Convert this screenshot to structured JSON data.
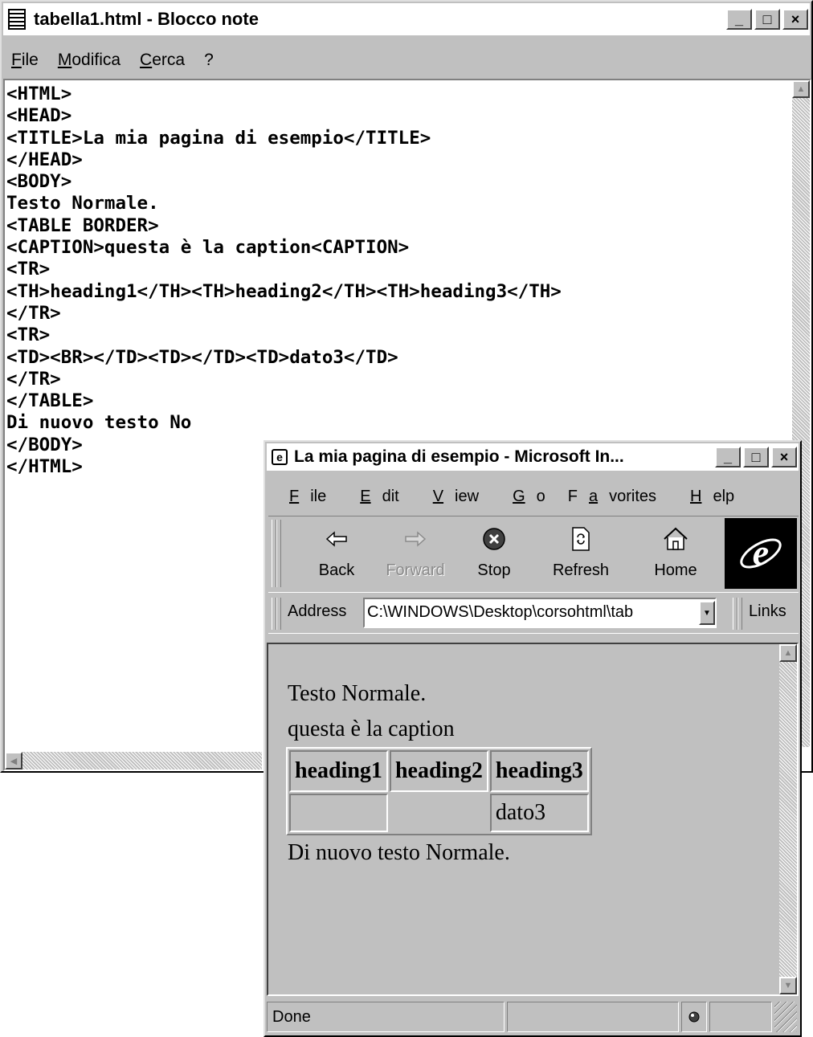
{
  "notepad": {
    "title": "tabella1.html - Blocco note",
    "menu": [
      "File",
      "Modifica",
      "Cerca",
      "?"
    ],
    "window_buttons": [
      "_",
      "□",
      "×"
    ],
    "content": "<HTML>\n<HEAD>\n<TITLE>La mia pagina di esempio</TITLE>\n</HEAD>\n<BODY>\nTesto Normale.\n<TABLE BORDER>\n<CAPTION>questa è la caption<CAPTION>\n<TR>\n<TH>heading1</TH><TH>heading2</TH><TH>heading3</TH>\n</TR>\n<TR>\n<TD><BR></TD><TD></TD><TD>dato3</TD>\n</TR>\n</TABLE>\nDi nuovo testo No\n</BODY>\n</HTML>"
  },
  "browser": {
    "title": "La mia pagina di esempio - Microsoft In...",
    "window_buttons": [
      "_",
      "□",
      "×"
    ],
    "menu": [
      {
        "pre": "",
        "ul": "F",
        "post": "ile"
      },
      {
        "pre": "",
        "ul": "E",
        "post": "dit"
      },
      {
        "pre": "",
        "ul": "V",
        "post": "iew"
      },
      {
        "pre": "",
        "ul": "G",
        "post": "o"
      },
      {
        "pre": "F",
        "ul": "a",
        "post": "vorites"
      },
      {
        "pre": "",
        "ul": "H",
        "post": "elp"
      }
    ],
    "toolbar": {
      "back": "Back",
      "forward": "Forward",
      "stop": "Stop",
      "refresh": "Refresh",
      "home": "Home"
    },
    "address_label": "Address",
    "address_value": "C:\\WINDOWS\\Desktop\\corsohtml\\tab",
    "links_label": "Links",
    "page": {
      "line1": "Testo Normale.",
      "caption": "questa è la caption",
      "headers": [
        "heading1",
        "heading2",
        "heading3"
      ],
      "row": [
        "",
        "",
        "dato3"
      ],
      "line2": "Di nuovo testo Normale."
    },
    "status": "Done"
  }
}
